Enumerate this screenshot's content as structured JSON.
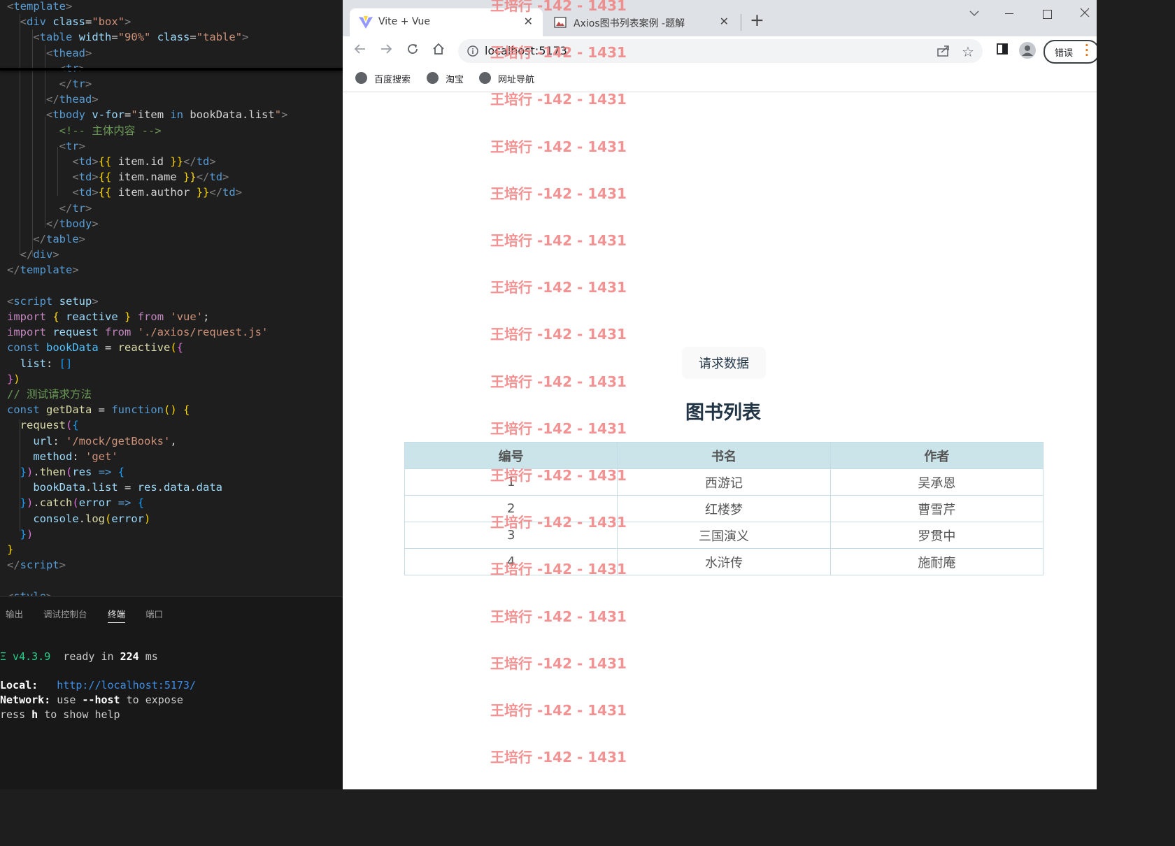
{
  "colors": {
    "tag": "#569cd6",
    "bracket": "#808080",
    "attr": "#9cdcfe",
    "string": "#ce9178",
    "comment": "#6a9955",
    "plain": "#d4d4d4",
    "keyword": "#c586c0",
    "storage": "#569cd6",
    "function": "#dcdcaa",
    "brace": "#ffd700",
    "brace2": "#da70d6",
    "brace3": "#179fff",
    "variable": "#9cdcfe",
    "constant": "#4fc1ff"
  },
  "editor": {
    "lines": [
      [
        [
          "bracket",
          "<"
        ],
        [
          "tag",
          "template"
        ],
        [
          "bracket",
          ">"
        ]
      ],
      [
        [
          "plain",
          "  "
        ],
        [
          "bracket",
          "<"
        ],
        [
          "tag",
          "div"
        ],
        [
          "plain",
          " "
        ],
        [
          "attr",
          "class"
        ],
        [
          "plain",
          "="
        ],
        [
          "string",
          "\"box\""
        ],
        [
          "bracket",
          ">"
        ]
      ],
      [
        [
          "plain",
          "    "
        ],
        [
          "bracket",
          "<"
        ],
        [
          "tag",
          "table"
        ],
        [
          "plain",
          " "
        ],
        [
          "attr",
          "width"
        ],
        [
          "plain",
          "="
        ],
        [
          "string",
          "\"90%\""
        ],
        [
          "plain",
          " "
        ],
        [
          "attr",
          "class"
        ],
        [
          "plain",
          "="
        ],
        [
          "string",
          "\"table\""
        ],
        [
          "bracket",
          ">"
        ]
      ],
      [
        [
          "plain",
          "      "
        ],
        [
          "bracket",
          "<"
        ],
        [
          "tag",
          "thead"
        ],
        [
          "bracket",
          ">"
        ]
      ],
      [
        [
          "plain",
          "        "
        ],
        [
          "bracket",
          "<"
        ],
        [
          "tag",
          "tr"
        ],
        [
          "bracket",
          ">"
        ]
      ],
      [
        [
          "plain",
          "        "
        ],
        [
          "bracket",
          "</"
        ],
        [
          "tag",
          "tr"
        ],
        [
          "bracket",
          ">"
        ]
      ],
      [
        [
          "plain",
          "      "
        ],
        [
          "bracket",
          "</"
        ],
        [
          "tag",
          "thead"
        ],
        [
          "bracket",
          ">"
        ]
      ],
      [
        [
          "plain",
          "      "
        ],
        [
          "bracket",
          "<"
        ],
        [
          "tag",
          "tbody"
        ],
        [
          "plain",
          " "
        ],
        [
          "attr",
          "v-for"
        ],
        [
          "plain",
          "="
        ],
        [
          "string",
          "\""
        ],
        [
          "plain",
          "item "
        ],
        [
          "storage",
          "in"
        ],
        [
          "plain",
          " bookData.list"
        ],
        [
          "string",
          "\""
        ],
        [
          "bracket",
          ">"
        ]
      ],
      [
        [
          "plain",
          "        "
        ],
        [
          "comment",
          "<!-- 主体内容 -->"
        ]
      ],
      [
        [
          "plain",
          "        "
        ],
        [
          "bracket",
          "<"
        ],
        [
          "tag",
          "tr"
        ],
        [
          "bracket",
          ">"
        ]
      ],
      [
        [
          "plain",
          "          "
        ],
        [
          "bracket",
          "<"
        ],
        [
          "tag",
          "td"
        ],
        [
          "bracket",
          ">"
        ],
        [
          "brace",
          "{{"
        ],
        [
          "plain",
          " item.id "
        ],
        [
          "brace",
          "}}"
        ],
        [
          "bracket",
          "</"
        ],
        [
          "tag",
          "td"
        ],
        [
          "bracket",
          ">"
        ]
      ],
      [
        [
          "plain",
          "          "
        ],
        [
          "bracket",
          "<"
        ],
        [
          "tag",
          "td"
        ],
        [
          "bracket",
          ">"
        ],
        [
          "brace",
          "{{"
        ],
        [
          "plain",
          " item.name "
        ],
        [
          "brace",
          "}}"
        ],
        [
          "bracket",
          "</"
        ],
        [
          "tag",
          "td"
        ],
        [
          "bracket",
          ">"
        ]
      ],
      [
        [
          "plain",
          "          "
        ],
        [
          "bracket",
          "<"
        ],
        [
          "tag",
          "td"
        ],
        [
          "bracket",
          ">"
        ],
        [
          "brace",
          "{{"
        ],
        [
          "plain",
          " item.author "
        ],
        [
          "brace",
          "}}"
        ],
        [
          "bracket",
          "</"
        ],
        [
          "tag",
          "td"
        ],
        [
          "bracket",
          ">"
        ]
      ],
      [
        [
          "plain",
          "        "
        ],
        [
          "bracket",
          "</"
        ],
        [
          "tag",
          "tr"
        ],
        [
          "bracket",
          ">"
        ]
      ],
      [
        [
          "plain",
          "      "
        ],
        [
          "bracket",
          "</"
        ],
        [
          "tag",
          "tbody"
        ],
        [
          "bracket",
          ">"
        ]
      ],
      [
        [
          "plain",
          "    "
        ],
        [
          "bracket",
          "</"
        ],
        [
          "tag",
          "table"
        ],
        [
          "bracket",
          ">"
        ]
      ],
      [
        [
          "plain",
          "  "
        ],
        [
          "bracket",
          "</"
        ],
        [
          "tag",
          "div"
        ],
        [
          "bracket",
          ">"
        ]
      ],
      [
        [
          "bracket",
          "</"
        ],
        [
          "tag",
          "template"
        ],
        [
          "bracket",
          ">"
        ]
      ],
      [],
      [
        [
          "bracket",
          "<"
        ],
        [
          "tag",
          "script"
        ],
        [
          "plain",
          " "
        ],
        [
          "attr",
          "setup"
        ],
        [
          "bracket",
          ">"
        ]
      ],
      [
        [
          "keyword",
          "import"
        ],
        [
          "plain",
          " "
        ],
        [
          "brace",
          "{"
        ],
        [
          "plain",
          " "
        ],
        [
          "variable",
          "reactive"
        ],
        [
          "plain",
          " "
        ],
        [
          "brace",
          "}"
        ],
        [
          "plain",
          " "
        ],
        [
          "keyword",
          "from"
        ],
        [
          "plain",
          " "
        ],
        [
          "string",
          "'vue'"
        ],
        [
          "plain",
          ";"
        ]
      ],
      [
        [
          "keyword",
          "import"
        ],
        [
          "plain",
          " "
        ],
        [
          "variable",
          "request"
        ],
        [
          "plain",
          " "
        ],
        [
          "keyword",
          "from"
        ],
        [
          "plain",
          " "
        ],
        [
          "string",
          "'./axios/request.js'"
        ]
      ],
      [
        [
          "storage",
          "const"
        ],
        [
          "plain",
          " "
        ],
        [
          "constant",
          "bookData"
        ],
        [
          "plain",
          " = "
        ],
        [
          "function",
          "reactive"
        ],
        [
          "brace",
          "("
        ],
        [
          "brace2",
          "{"
        ]
      ],
      [
        [
          "plain",
          "  "
        ],
        [
          "variable",
          "list"
        ],
        [
          "plain",
          ": "
        ],
        [
          "brace3",
          "[]"
        ]
      ],
      [
        [
          "brace2",
          "}"
        ],
        [
          "brace",
          ")"
        ]
      ],
      [
        [
          "comment",
          "// 测试请求方法"
        ]
      ],
      [
        [
          "storage",
          "const"
        ],
        [
          "plain",
          " "
        ],
        [
          "function",
          "getData"
        ],
        [
          "plain",
          " = "
        ],
        [
          "storage",
          "function"
        ],
        [
          "brace",
          "()"
        ],
        [
          "plain",
          " "
        ],
        [
          "brace",
          "{"
        ]
      ],
      [
        [
          "plain",
          "  "
        ],
        [
          "function",
          "request"
        ],
        [
          "brace2",
          "("
        ],
        [
          "brace3",
          "{"
        ]
      ],
      [
        [
          "plain",
          "    "
        ],
        [
          "variable",
          "url"
        ],
        [
          "plain",
          ": "
        ],
        [
          "string",
          "'/mock/getBooks'"
        ],
        [
          "plain",
          ","
        ]
      ],
      [
        [
          "plain",
          "    "
        ],
        [
          "variable",
          "method"
        ],
        [
          "plain",
          ": "
        ],
        [
          "string",
          "'get'"
        ]
      ],
      [
        [
          "plain",
          "  "
        ],
        [
          "brace3",
          "}"
        ],
        [
          "brace2",
          ")"
        ],
        [
          "plain",
          "."
        ],
        [
          "function",
          "then"
        ],
        [
          "brace2",
          "("
        ],
        [
          "variable",
          "res"
        ],
        [
          "plain",
          " "
        ],
        [
          "storage",
          "=>"
        ],
        [
          "plain",
          " "
        ],
        [
          "brace3",
          "{"
        ]
      ],
      [
        [
          "plain",
          "    "
        ],
        [
          "variable",
          "bookData"
        ],
        [
          "plain",
          "."
        ],
        [
          "variable",
          "list"
        ],
        [
          "plain",
          " = "
        ],
        [
          "variable",
          "res"
        ],
        [
          "plain",
          "."
        ],
        [
          "variable",
          "data"
        ],
        [
          "plain",
          "."
        ],
        [
          "variable",
          "data"
        ]
      ],
      [
        [
          "plain",
          "  "
        ],
        [
          "brace3",
          "}"
        ],
        [
          "brace2",
          ")"
        ],
        [
          "plain",
          "."
        ],
        [
          "function",
          "catch"
        ],
        [
          "brace2",
          "("
        ],
        [
          "variable",
          "error"
        ],
        [
          "plain",
          " "
        ],
        [
          "storage",
          "=>"
        ],
        [
          "plain",
          " "
        ],
        [
          "brace3",
          "{"
        ]
      ],
      [
        [
          "plain",
          "    "
        ],
        [
          "variable",
          "console"
        ],
        [
          "plain",
          "."
        ],
        [
          "function",
          "log"
        ],
        [
          "brace",
          "("
        ],
        [
          "variable",
          "error"
        ],
        [
          "brace",
          ")"
        ]
      ],
      [
        [
          "plain",
          "  "
        ],
        [
          "brace3",
          "}"
        ],
        [
          "brace2",
          ")"
        ]
      ],
      [
        [
          "brace",
          "}"
        ]
      ],
      [
        [
          "bracket",
          "</"
        ],
        [
          "tag",
          "script"
        ],
        [
          "bracket",
          ">"
        ]
      ],
      [],
      [
        [
          "bracket",
          "<"
        ],
        [
          "tag",
          "style"
        ],
        [
          "bracket",
          ">"
        ]
      ]
    ]
  },
  "panel": {
    "tabs": [
      "输出",
      "调试控制台",
      "终端",
      "端口"
    ],
    "active_tab": "终端",
    "terminal": [
      [
        [
          "#23d18b",
          "Ξ v4.3.9"
        ],
        [
          "#cccccc",
          "  ready in "
        ],
        [
          "#ffffff",
          "224"
        ],
        [
          "#cccccc",
          " ms"
        ]
      ],
      [],
      [
        [
          "#ffffff",
          "Local:"
        ],
        [
          "#cccccc",
          "   "
        ],
        [
          "#3b8eea",
          "http://localhost:"
        ],
        [
          "#3b8eea",
          "5173"
        ],
        [
          "#3b8eea",
          "/"
        ]
      ],
      [
        [
          "#ffffff",
          "Network:"
        ],
        [
          "#cccccc",
          " use "
        ],
        [
          "#ffffff",
          "--host"
        ],
        [
          "#cccccc",
          " to expose"
        ]
      ],
      [
        [
          "#cccccc",
          "ress "
        ],
        [
          "#ffffff",
          "h"
        ],
        [
          "#cccccc",
          " to show help"
        ]
      ]
    ]
  },
  "browser": {
    "tabs": [
      {
        "title": "Vite + Vue",
        "close": "✕"
      },
      {
        "title": "Axios图书列表案例 -题解",
        "close": "✕"
      }
    ],
    "new_tab": "+",
    "address": "localhost:5173",
    "profile_button": "错误",
    "bookmarks": [
      "百度搜索",
      "淘宝",
      "网址导航"
    ]
  },
  "page": {
    "button": "请求数据",
    "title": "图书列表",
    "columns": [
      "编号",
      "书名",
      "作者"
    ],
    "rows": [
      [
        "1",
        "西游记",
        "吴承恩"
      ],
      [
        "2",
        "红楼梦",
        "曹雪芹"
      ],
      [
        "3",
        "三国演义",
        "罗贯中"
      ],
      [
        "4",
        "水浒传",
        "施耐庵"
      ]
    ]
  },
  "watermark": "王培行 -142 - 1431"
}
